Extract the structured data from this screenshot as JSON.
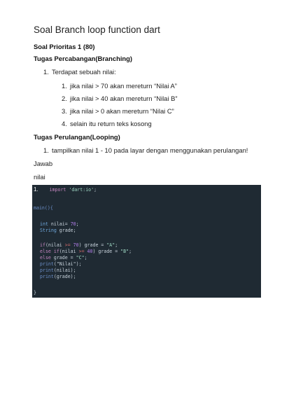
{
  "title": "Soal Branch loop function dart",
  "priority": "Soal Prioritas 1 (80)",
  "branching_heading": "Tugas Percabangan(Branching)",
  "branching_item": "Terdapat sebuah nilai:",
  "branching_subitems": [
    "jika nilai > 70 akan mereturn “Nilai A”",
    "jika nilai > 40 akan mereturn “Nilai B”",
    "jika nilai > 0 akan mereturn “Nilai C”",
    "selain itu return teks kosong"
  ],
  "looping_heading": "Tugas Perulangan(Looping)",
  "looping_item": "tampilkan nilai 1 - 10 pada layar dengan menggunakan perulangan!",
  "jawab": "Jawab",
  "nilai_label": "nilai",
  "code": {
    "line_number": "1.",
    "import_kw": "import",
    "import_str": "'dart:io'",
    "main": "main(){",
    "int_kw": "int",
    "int_rest": " nilai= ",
    "int_val": "70",
    "string_kw": "String",
    "string_rest": " grade;",
    "if1_kw": "if",
    "if1_a": "(nilai ",
    "if1_op": ">=",
    "if1_num": " 70",
    "if1_b": ") grade = ",
    "if1_str": "\"A\"",
    "elif_kw": "else if",
    "elif_a": "(nilai ",
    "elif_op": ">=",
    "elif_num": " 40",
    "elif_b": ") grade = ",
    "elif_str": "\"B\"",
    "else_kw": "else",
    "else_a": " grade = ",
    "else_str": "\"C\"",
    "print1_fn": "print",
    "print1_str": "(\"Nilai\");",
    "print2_fn": "print",
    "print2_arg": "(nilai);",
    "print3_fn": "print",
    "print3_arg": "(grade);",
    "closing": "}"
  }
}
